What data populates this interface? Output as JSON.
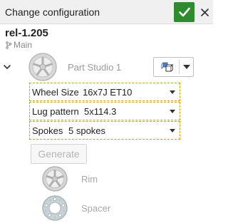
{
  "header": {
    "title": "Change configuration",
    "ok_icon": "checkmark-icon",
    "close_icon": "close-icon",
    "ok_color": "#2e8b2e"
  },
  "document": {
    "version": "rel-1.205",
    "branch": "Main",
    "branch_icon": "branch-icon"
  },
  "tree": {
    "studio_name": "Part Studio 1",
    "insert_icon": "assembly-insert-icon",
    "configuration": [
      {
        "label": "Wheel Size",
        "value": "16x7J ET10"
      },
      {
        "label": "Lug pattern",
        "value": "5x114.3"
      },
      {
        "label": "Spokes",
        "value": "5 spokes"
      }
    ],
    "generate_label": "Generate",
    "parts": [
      {
        "name": "Rim",
        "icon": "rim-icon"
      },
      {
        "name": "Spacer",
        "icon": "spacer-icon"
      }
    ]
  },
  "colors": {
    "highlight_border": "#d3a400",
    "muted_text": "#9a9a9a"
  }
}
